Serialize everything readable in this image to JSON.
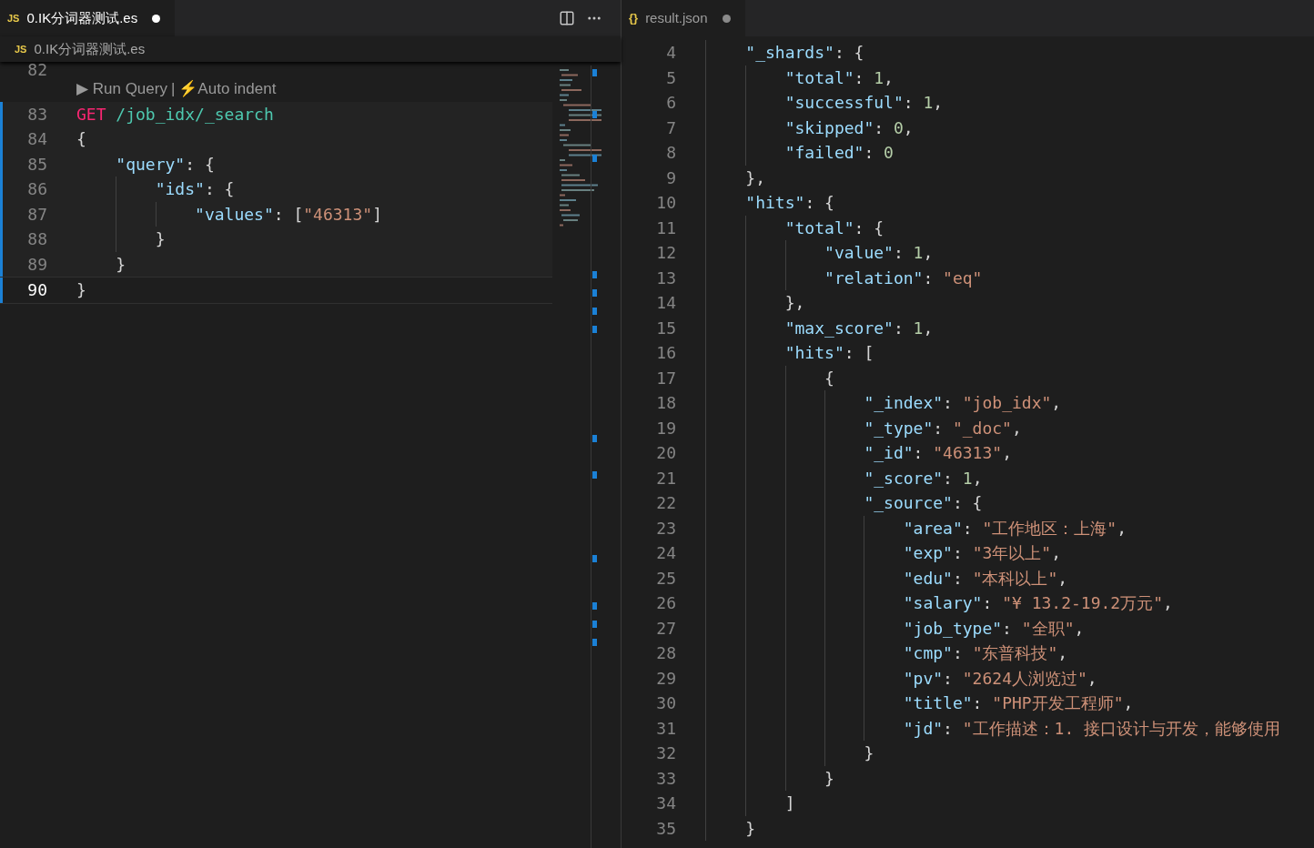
{
  "left_editor": {
    "tab": {
      "icon": "JS",
      "label": "0.IK分词器测试.es",
      "dirty": true,
      "focused": true
    },
    "breadcrumb": {
      "icon": "JS",
      "label": "0.IK分词器测试.es"
    },
    "first_line": {
      "number": "82",
      "modified": false,
      "active": false
    },
    "codelens": {
      "links": [
        "▶ Run Query",
        "⚡Auto indent"
      ],
      "separator": "|"
    },
    "lines": [
      {
        "number": "83",
        "modified": true,
        "active": false,
        "tokens": [
          {
            "text": "GET",
            "kind": "method"
          },
          {
            "text": " /job_idx/_search",
            "kind": "path"
          }
        ]
      },
      {
        "number": "84",
        "modified": true,
        "active": false,
        "tokens": [
          {
            "text": "{",
            "kind": "punct"
          }
        ]
      },
      {
        "number": "85",
        "modified": true,
        "active": false,
        "tokens": [
          {
            "text": "    \"query\"",
            "kind": "key"
          },
          {
            "text": ": {",
            "kind": "punct"
          }
        ]
      },
      {
        "number": "86",
        "modified": true,
        "active": false,
        "tokens": [
          {
            "text": "        \"ids\"",
            "kind": "key"
          },
          {
            "text": ": {",
            "kind": "punct"
          }
        ]
      },
      {
        "number": "87",
        "modified": true,
        "active": false,
        "tokens": [
          {
            "text": "            \"values\"",
            "kind": "key"
          },
          {
            "text": ": [",
            "kind": "punct"
          },
          {
            "text": "\"46313\"",
            "kind": "str"
          },
          {
            "text": "]",
            "kind": "punct"
          }
        ]
      },
      {
        "number": "88",
        "modified": true,
        "active": false,
        "tokens": [
          {
            "text": "        }",
            "kind": "punct"
          }
        ]
      },
      {
        "number": "89",
        "modified": true,
        "active": false,
        "tokens": [
          {
            "text": "    }",
            "kind": "punct"
          }
        ]
      },
      {
        "number": "90",
        "modified": true,
        "active": true,
        "tokens": [
          {
            "text": "}",
            "kind": "punct"
          }
        ]
      }
    ]
  },
  "right_editor": {
    "tab": {
      "icon": "{}",
      "label": "result.json",
      "dirty": true,
      "focused": false
    },
    "lines": [
      {
        "number": "4",
        "tokens": [
          {
            "text": "    \"_shards\"",
            "kind": "key"
          },
          {
            "text": ": {",
            "kind": "punct"
          }
        ]
      },
      {
        "number": "5",
        "tokens": [
          {
            "text": "        \"total\"",
            "kind": "key"
          },
          {
            "text": ": ",
            "kind": "punct"
          },
          {
            "text": "1",
            "kind": "num"
          },
          {
            "text": ",",
            "kind": "punct"
          }
        ]
      },
      {
        "number": "6",
        "tokens": [
          {
            "text": "        \"successful\"",
            "kind": "key"
          },
          {
            "text": ": ",
            "kind": "punct"
          },
          {
            "text": "1",
            "kind": "num"
          },
          {
            "text": ",",
            "kind": "punct"
          }
        ]
      },
      {
        "number": "7",
        "tokens": [
          {
            "text": "        \"skipped\"",
            "kind": "key"
          },
          {
            "text": ": ",
            "kind": "punct"
          },
          {
            "text": "0",
            "kind": "num"
          },
          {
            "text": ",",
            "kind": "punct"
          }
        ]
      },
      {
        "number": "8",
        "tokens": [
          {
            "text": "        \"failed\"",
            "kind": "key"
          },
          {
            "text": ": ",
            "kind": "punct"
          },
          {
            "text": "0",
            "kind": "num"
          }
        ]
      },
      {
        "number": "9",
        "tokens": [
          {
            "text": "    },",
            "kind": "punct"
          }
        ]
      },
      {
        "number": "10",
        "tokens": [
          {
            "text": "    \"hits\"",
            "kind": "key"
          },
          {
            "text": ": {",
            "kind": "punct"
          }
        ]
      },
      {
        "number": "11",
        "tokens": [
          {
            "text": "        \"total\"",
            "kind": "key"
          },
          {
            "text": ": {",
            "kind": "punct"
          }
        ]
      },
      {
        "number": "12",
        "tokens": [
          {
            "text": "            \"value\"",
            "kind": "key"
          },
          {
            "text": ": ",
            "kind": "punct"
          },
          {
            "text": "1",
            "kind": "num"
          },
          {
            "text": ",",
            "kind": "punct"
          }
        ]
      },
      {
        "number": "13",
        "tokens": [
          {
            "text": "            \"relation\"",
            "kind": "key"
          },
          {
            "text": ": ",
            "kind": "punct"
          },
          {
            "text": "\"eq\"",
            "kind": "str"
          }
        ]
      },
      {
        "number": "14",
        "tokens": [
          {
            "text": "        },",
            "kind": "punct"
          }
        ]
      },
      {
        "number": "15",
        "tokens": [
          {
            "text": "        \"max_score\"",
            "kind": "key"
          },
          {
            "text": ": ",
            "kind": "punct"
          },
          {
            "text": "1",
            "kind": "num"
          },
          {
            "text": ",",
            "kind": "punct"
          }
        ]
      },
      {
        "number": "16",
        "tokens": [
          {
            "text": "        \"hits\"",
            "kind": "key"
          },
          {
            "text": ": [",
            "kind": "punct"
          }
        ]
      },
      {
        "number": "17",
        "tokens": [
          {
            "text": "            {",
            "kind": "punct"
          }
        ]
      },
      {
        "number": "18",
        "tokens": [
          {
            "text": "                \"_index\"",
            "kind": "key"
          },
          {
            "text": ": ",
            "kind": "punct"
          },
          {
            "text": "\"job_idx\"",
            "kind": "str"
          },
          {
            "text": ",",
            "kind": "punct"
          }
        ]
      },
      {
        "number": "19",
        "tokens": [
          {
            "text": "                \"_type\"",
            "kind": "key"
          },
          {
            "text": ": ",
            "kind": "punct"
          },
          {
            "text": "\"_doc\"",
            "kind": "str"
          },
          {
            "text": ",",
            "kind": "punct"
          }
        ]
      },
      {
        "number": "20",
        "tokens": [
          {
            "text": "                \"_id\"",
            "kind": "key"
          },
          {
            "text": ": ",
            "kind": "punct"
          },
          {
            "text": "\"46313\"",
            "kind": "str"
          },
          {
            "text": ",",
            "kind": "punct"
          }
        ]
      },
      {
        "number": "21",
        "tokens": [
          {
            "text": "                \"_score\"",
            "kind": "key"
          },
          {
            "text": ": ",
            "kind": "punct"
          },
          {
            "text": "1",
            "kind": "num"
          },
          {
            "text": ",",
            "kind": "punct"
          }
        ]
      },
      {
        "number": "22",
        "tokens": [
          {
            "text": "                \"_source\"",
            "kind": "key"
          },
          {
            "text": ": {",
            "kind": "punct"
          }
        ]
      },
      {
        "number": "23",
        "tokens": [
          {
            "text": "                    \"area\"",
            "kind": "key"
          },
          {
            "text": ": ",
            "kind": "punct"
          },
          {
            "text": "\"工作地区：上海\"",
            "kind": "str"
          },
          {
            "text": ",",
            "kind": "punct"
          }
        ]
      },
      {
        "number": "24",
        "tokens": [
          {
            "text": "                    \"exp\"",
            "kind": "key"
          },
          {
            "text": ": ",
            "kind": "punct"
          },
          {
            "text": "\"3年以上\"",
            "kind": "str"
          },
          {
            "text": ",",
            "kind": "punct"
          }
        ]
      },
      {
        "number": "25",
        "tokens": [
          {
            "text": "                    \"edu\"",
            "kind": "key"
          },
          {
            "text": ": ",
            "kind": "punct"
          },
          {
            "text": "\"本科以上\"",
            "kind": "str"
          },
          {
            "text": ",",
            "kind": "punct"
          }
        ]
      },
      {
        "number": "26",
        "tokens": [
          {
            "text": "                    \"salary\"",
            "kind": "key"
          },
          {
            "text": ": ",
            "kind": "punct"
          },
          {
            "text": "\"¥ 13.2-19.2万元\"",
            "kind": "str"
          },
          {
            "text": ",",
            "kind": "punct"
          }
        ]
      },
      {
        "number": "27",
        "tokens": [
          {
            "text": "                    \"job_type\"",
            "kind": "key"
          },
          {
            "text": ": ",
            "kind": "punct"
          },
          {
            "text": "\"全职\"",
            "kind": "str"
          },
          {
            "text": ",",
            "kind": "punct"
          }
        ]
      },
      {
        "number": "28",
        "tokens": [
          {
            "text": "                    \"cmp\"",
            "kind": "key"
          },
          {
            "text": ": ",
            "kind": "punct"
          },
          {
            "text": "\"东普科技\"",
            "kind": "str"
          },
          {
            "text": ",",
            "kind": "punct"
          }
        ]
      },
      {
        "number": "29",
        "tokens": [
          {
            "text": "                    \"pv\"",
            "kind": "key"
          },
          {
            "text": ": ",
            "kind": "punct"
          },
          {
            "text": "\"2624人浏览过\"",
            "kind": "str"
          },
          {
            "text": ",",
            "kind": "punct"
          }
        ]
      },
      {
        "number": "30",
        "tokens": [
          {
            "text": "                    \"title\"",
            "kind": "key"
          },
          {
            "text": ": ",
            "kind": "punct"
          },
          {
            "text": "\"PHP开发工程师\"",
            "kind": "str"
          },
          {
            "text": ",",
            "kind": "punct"
          }
        ]
      },
      {
        "number": "31",
        "tokens": [
          {
            "text": "                    \"jd\"",
            "kind": "key"
          },
          {
            "text": ": ",
            "kind": "punct"
          },
          {
            "text": "\"工作描述：1. 接口设计与开发，能够使用",
            "kind": "str"
          }
        ]
      },
      {
        "number": "32",
        "tokens": [
          {
            "text": "                }",
            "kind": "punct"
          }
        ]
      },
      {
        "number": "33",
        "tokens": [
          {
            "text": "            }",
            "kind": "punct"
          }
        ]
      },
      {
        "number": "34",
        "tokens": [
          {
            "text": "        ]",
            "kind": "punct"
          }
        ]
      },
      {
        "number": "35",
        "tokens": [
          {
            "text": "    }",
            "kind": "punct"
          }
        ]
      }
    ]
  }
}
